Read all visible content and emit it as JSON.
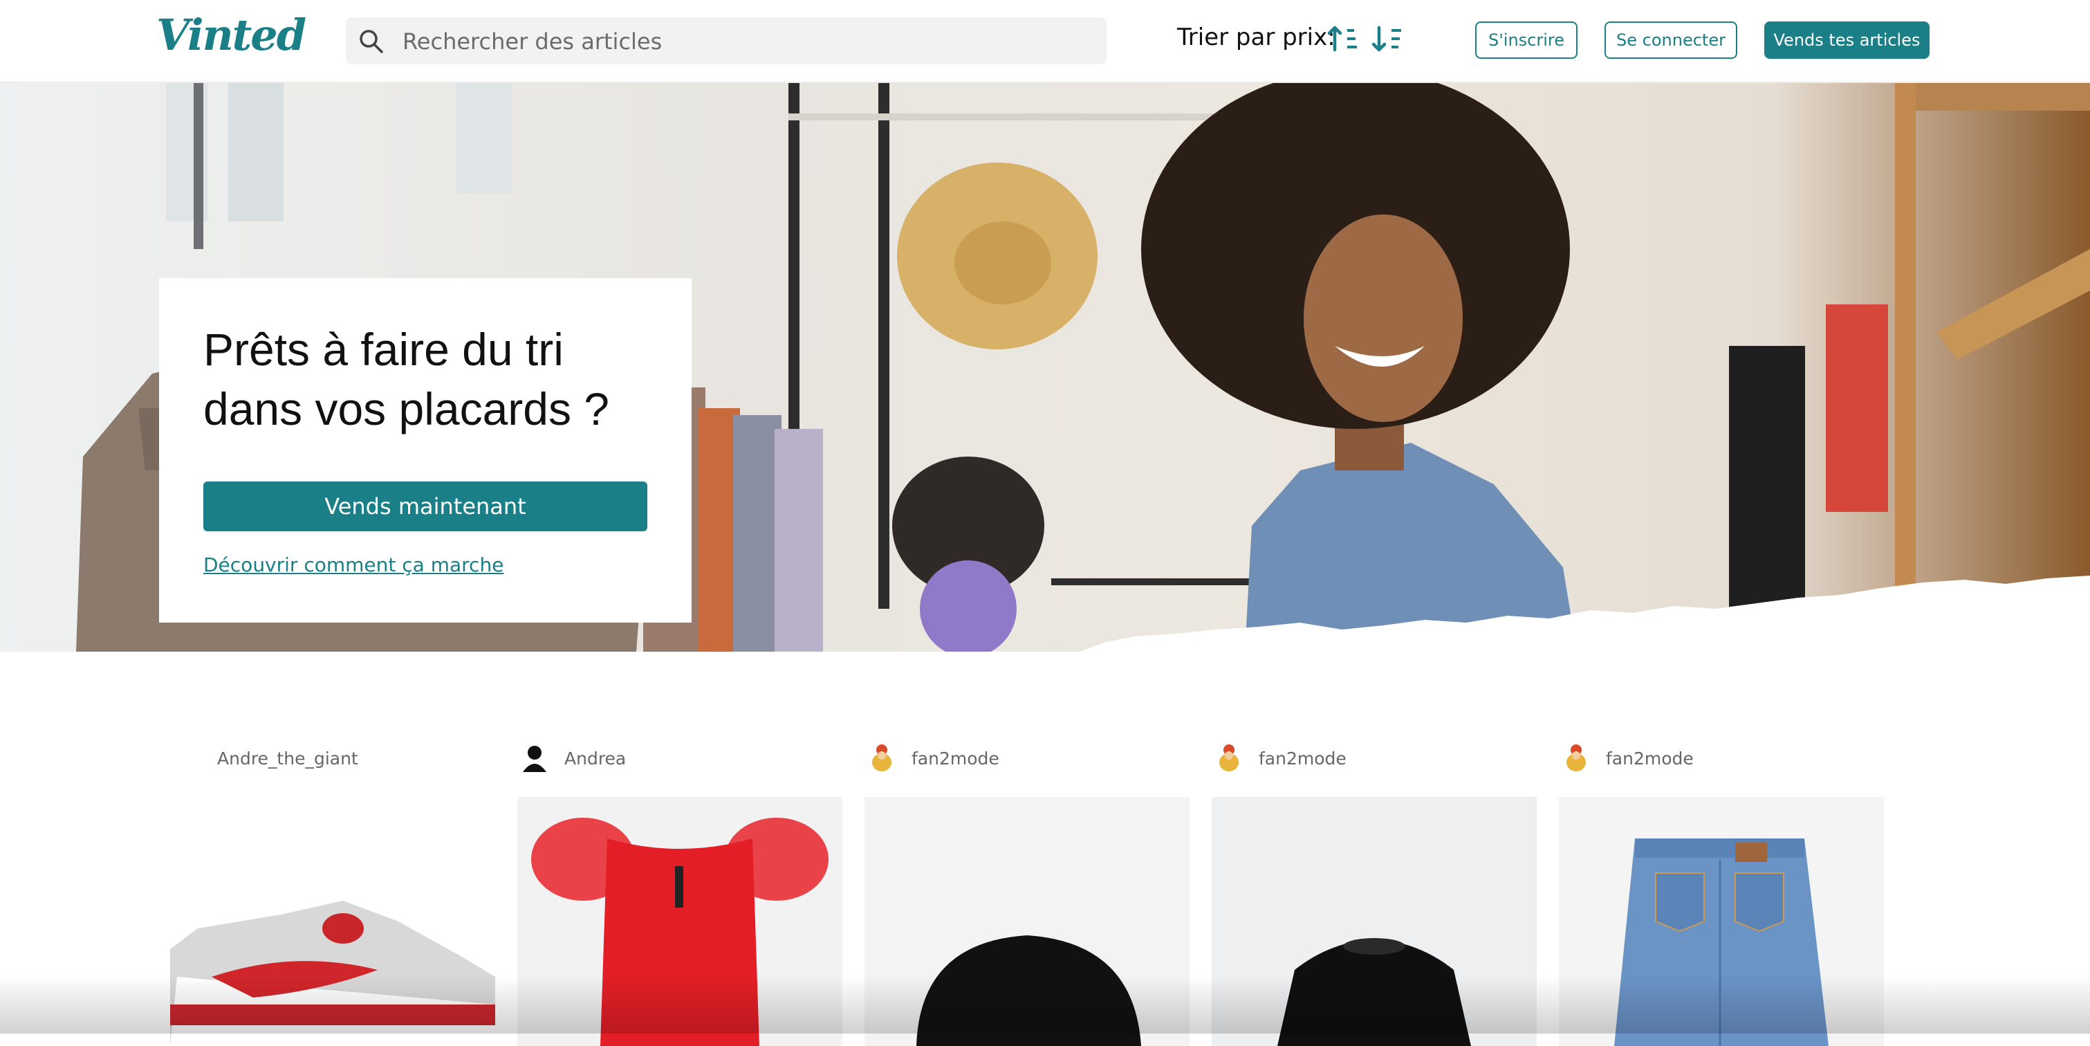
{
  "brand": {
    "logo": "Vinted",
    "accent": "#1a7f86"
  },
  "header": {
    "search_placeholder": "Rechercher des articles",
    "sort_label": "Trier par prix:",
    "sort_asc_icon": "sort-ascending-icon",
    "sort_desc_icon": "sort-descending-icon",
    "signup_label": "S'inscrire",
    "login_label": "Se connecter",
    "sell_label": "Vends tes articles"
  },
  "hero": {
    "title": "Prêts à faire du tri dans vos placards ?",
    "cta_label": "Vends maintenant",
    "learn_link": "Découvrir comment ça marche"
  },
  "items": [
    {
      "username": "Andre_the_giant",
      "image": "sneaker-photo"
    },
    {
      "username": "Andrea",
      "image": "red-top-photo"
    },
    {
      "username": "fan2mode",
      "image": "black-beanie-photo"
    },
    {
      "username": "fan2mode",
      "image": "black-sweater-photo"
    },
    {
      "username": "fan2mode",
      "image": "blue-jeans-photo"
    }
  ]
}
